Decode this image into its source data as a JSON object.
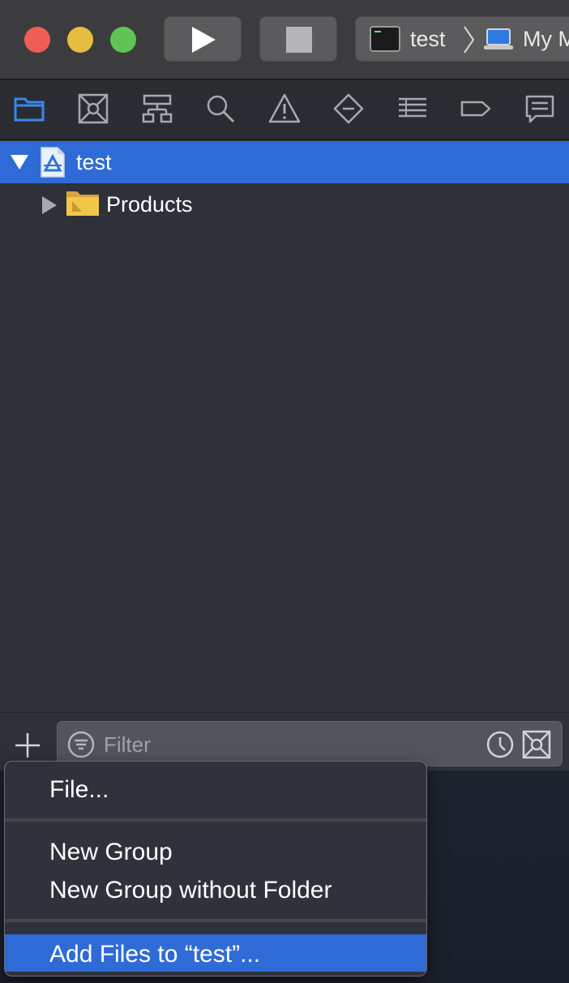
{
  "titlebar": {
    "scheme_name": "test",
    "destination": "My Mac"
  },
  "nav_tabs": [
    {
      "icon": "folder-icon",
      "active": true
    },
    {
      "icon": "source-control-icon",
      "active": false
    },
    {
      "icon": "hierarchy-icon",
      "active": false
    },
    {
      "icon": "search-icon",
      "active": false
    },
    {
      "icon": "warning-icon",
      "active": false
    },
    {
      "icon": "breakpoint-test-icon",
      "active": false
    },
    {
      "icon": "debug-list-icon",
      "active": false
    },
    {
      "icon": "breakpoint-tag-icon",
      "active": false
    },
    {
      "icon": "report-icon",
      "active": false
    }
  ],
  "tree": {
    "project": {
      "label": "test",
      "expanded": true,
      "selected": true
    },
    "products": {
      "label": "Products",
      "expanded": false
    }
  },
  "filter": {
    "placeholder": "Filter"
  },
  "menu": {
    "items": [
      {
        "label": "File..."
      },
      {
        "label": "New Group"
      },
      {
        "label": "New Group without Folder"
      },
      {
        "label": "Add Files to “test”..."
      }
    ]
  },
  "colors": {
    "selection": "#2f6bd6",
    "sidebar_bg": "#2e3138",
    "titlebar_bg": "#3c3c3e",
    "traffic_red": "#ee5e57",
    "traffic_yellow": "#e5bd3f",
    "traffic_green": "#5fc454",
    "active_tab": "#3a86f0"
  }
}
